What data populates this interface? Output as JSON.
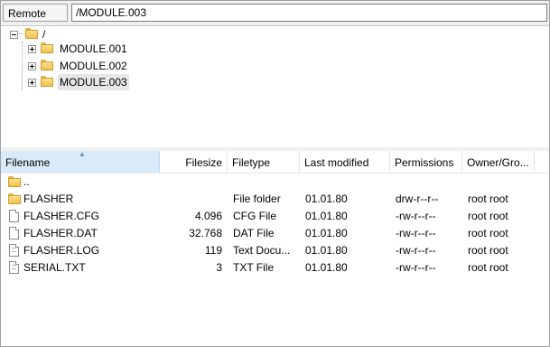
{
  "remote_site": {
    "label": "Remote site:",
    "path": "/MODULE.003"
  },
  "tree": {
    "root": "/",
    "children": [
      {
        "label": "MODULE.001",
        "selected": false
      },
      {
        "label": "MODULE.002",
        "selected": false
      },
      {
        "label": "MODULE.003",
        "selected": true
      }
    ]
  },
  "file_list": {
    "columns": [
      "Filename",
      "Filesize",
      "Filetype",
      "Last modified",
      "Permissions",
      "Owner/Gro..."
    ],
    "rows": [
      {
        "icon": "folder-icon",
        "name": "..",
        "size": "",
        "type": "",
        "modified": "",
        "permissions": "",
        "owner": ""
      },
      {
        "icon": "folder-icon",
        "name": "FLASHER",
        "size": "",
        "type": "File folder",
        "modified": "01.01.80",
        "permissions": "drw-r--r--",
        "owner": "root root"
      },
      {
        "icon": "file-icon",
        "name": "FLASHER.CFG",
        "size": "4.096",
        "type": "CFG File",
        "modified": "01.01.80",
        "permissions": "-rw-r--r--",
        "owner": "root root"
      },
      {
        "icon": "file-icon",
        "name": "FLASHER.DAT",
        "size": "32.768",
        "type": "DAT File",
        "modified": "01.01.80",
        "permissions": "-rw-r--r--",
        "owner": "root root"
      },
      {
        "icon": "text-file-icon",
        "name": "FLASHER.LOG",
        "size": "119",
        "type": "Text Docu...",
        "modified": "01.01.80",
        "permissions": "-rw-r--r--",
        "owner": "root root"
      },
      {
        "icon": "text-file-icon",
        "name": "SERIAL.TXT",
        "size": "3",
        "type": "TXT File",
        "modified": "01.01.80",
        "permissions": "-rw-r--r--",
        "owner": "root root"
      }
    ]
  },
  "colors": {
    "sorted_header_bg": "#d9ebf9",
    "folder_yellow": "#f0c050",
    "selection_bg": "#e6e6e6"
  }
}
